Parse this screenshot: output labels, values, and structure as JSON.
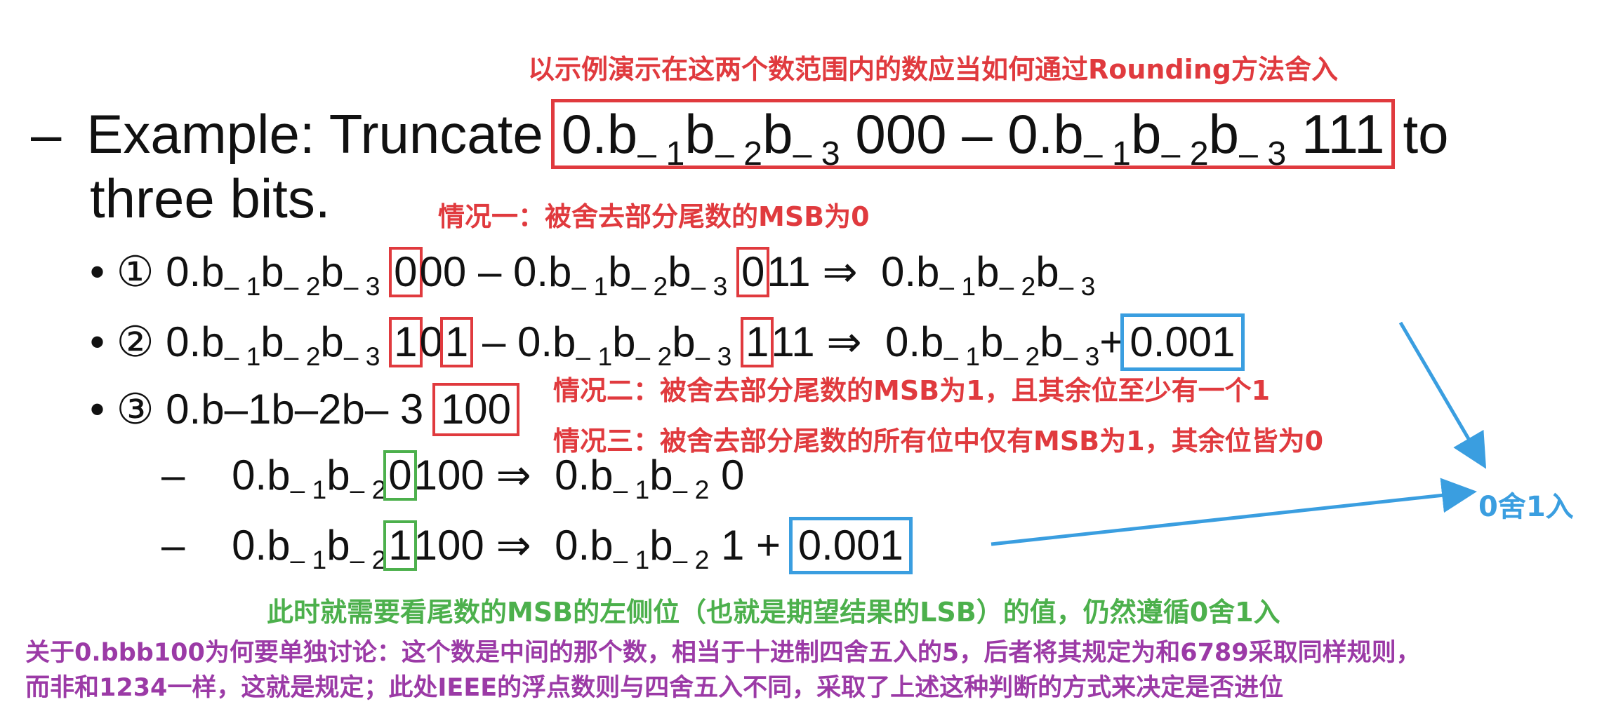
{
  "notes": {
    "top": "以示例演示在这两个数范围内的数应当如何通过Rounding方法舍入",
    "case1": "情况一：被舍去部分尾数的MSB为0",
    "case2": "情况二：被舍去部分尾数的MSB为1，且其余位至少有一个1",
    "case3": "情况三：被舍去部分尾数的所有位中仅有MSB为1，其余位皆为0",
    "round_rule": "0舍1入",
    "green": "此时就需要看尾数的MSB的左侧位（也就是期望结果的LSB）的值，仍然遵循0舍1入",
    "purple1": "关于0.bbb100为何要单独讨论：这个数是中间的那个数，相当于十进制四舍五入的5，后者将其规定为和6789采取同样规则，",
    "purple2": "而非和1234一样，这就是规定；此处IEEE的浮点数则与四舍五入不同，采取了上述这种判断的方式来决定是否进位"
  },
  "heading": {
    "dash": "–",
    "prefix": "Example: Truncate",
    "suffix": "to",
    "line2": "three bits."
  },
  "sym": {
    "b": "b",
    "minus": "–",
    "s1": "1",
    "s2": "2",
    "s3": "3",
    "zero_point": "0.",
    "bullet": "•",
    "arrow": "⇒",
    "plus": "+",
    "c1": "①",
    "c2": "②",
    "c3": "③",
    "range_dash": "–"
  },
  "values": {
    "low": "000",
    "high": "111",
    "i1_first": "0",
    "i1_rest_a": "00",
    "i1_mid": "0",
    "i1_rest_b": "11",
    "i2_a": "1",
    "i2_b": "0",
    "i2_c": "1",
    "i2_mid": "1",
    "i2_rest_b": "11",
    "i2_add": "0.001",
    "i3": "100",
    "s1_bit": "0",
    "s1_rest": "100",
    "s1_result": "0",
    "s2_bit": "1",
    "s2_rest": "100",
    "s2_result": "1",
    "s2_add": "0.001"
  },
  "colors": {
    "red": "#e03a3e",
    "blue": "#3a9ee0",
    "green": "#4cb04c",
    "purple": "#9b3aa6"
  }
}
